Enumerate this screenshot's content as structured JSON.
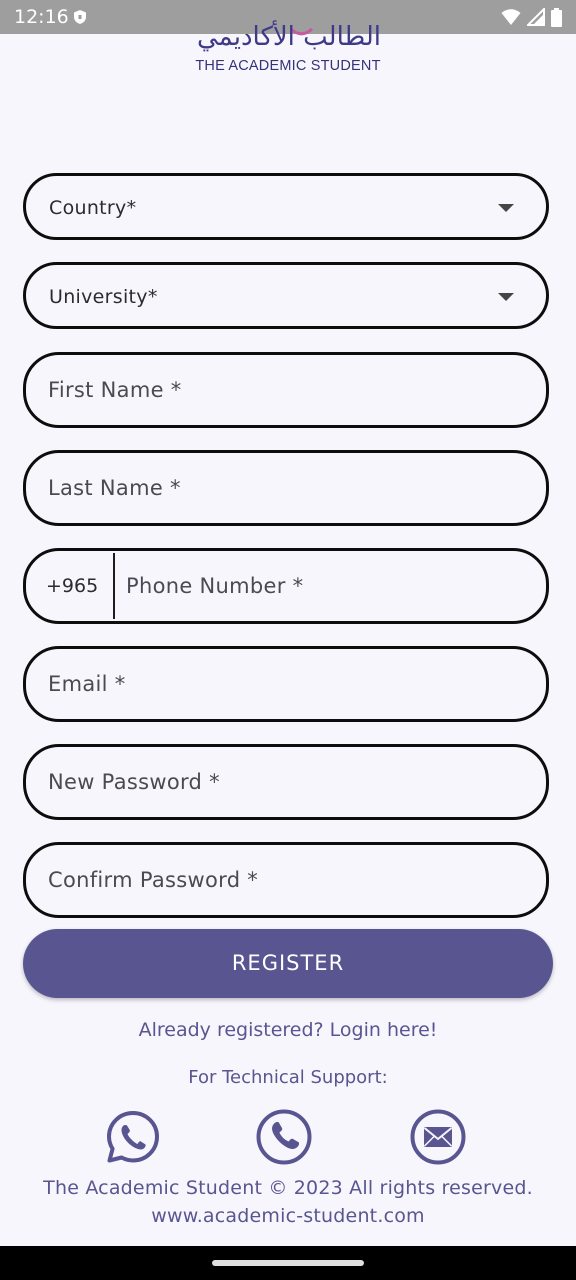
{
  "status_bar": {
    "time": "12:16"
  },
  "logo": {
    "arabic_name": "الطالب الأكاديمي",
    "english_name": "THE ACADEMIC STUDENT"
  },
  "form": {
    "country_label": "Country*",
    "university_label": "University*",
    "first_name_placeholder": "First Name *",
    "last_name_placeholder": "Last Name *",
    "phone_prefix": "+965",
    "phone_placeholder": "Phone Number *",
    "email_placeholder": "Email *",
    "new_password_placeholder": "New Password *",
    "confirm_password_placeholder": "Confirm Password *"
  },
  "register_label": "REGISTER",
  "login_link": "Already registered? Login here!",
  "support": {
    "label": "For Technical Support:",
    "icons": [
      "whatsapp-icon",
      "phone-icon",
      "email-icon"
    ]
  },
  "footer": {
    "copyright": "The Academic Student © 2023 All rights reserved.",
    "website": "www.academic-student.com"
  },
  "colors": {
    "brand": "#595591",
    "background": "#f8f6fd",
    "field_border": "#0d0d0d"
  }
}
